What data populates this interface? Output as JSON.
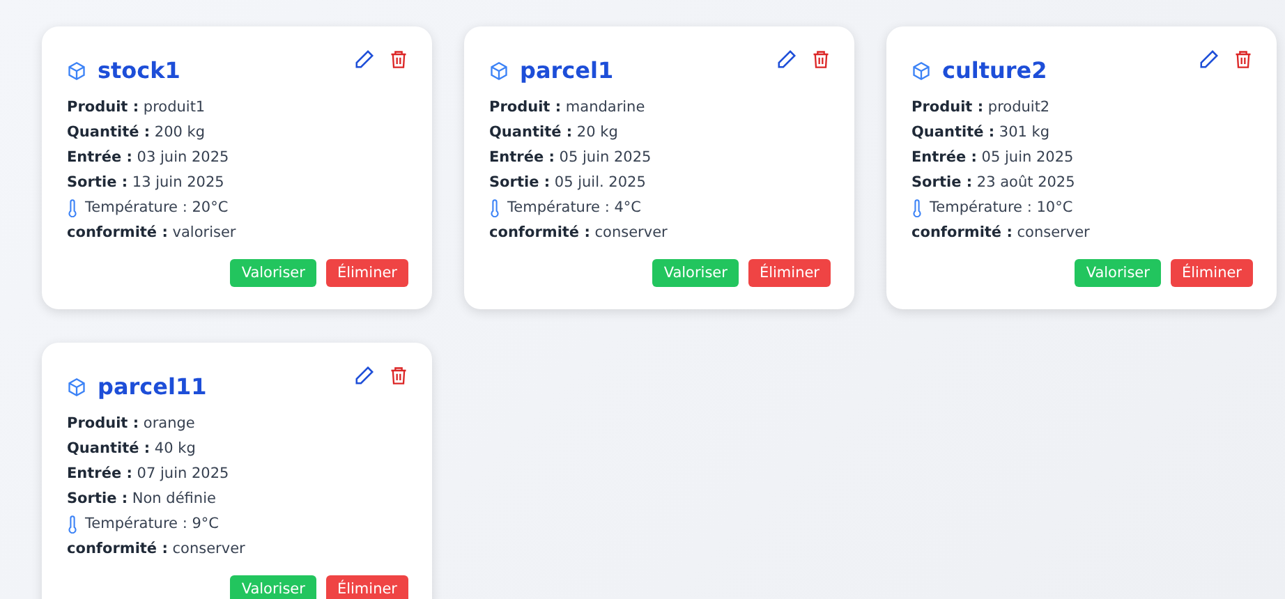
{
  "cards": [
    {
      "title": "stock1",
      "lines": [
        {
          "kind": "field",
          "label": "Produit :",
          "value": "produit1"
        },
        {
          "kind": "field",
          "label": "Quantité :",
          "value": "200 kg"
        },
        {
          "kind": "field",
          "label": "Entrée :",
          "value": "03 juin 2025"
        },
        {
          "kind": "field",
          "label": "Sortie :",
          "value": "13 juin 2025"
        },
        {
          "kind": "temperature",
          "value": "Température : 20°C"
        },
        {
          "kind": "field",
          "label": "conformité :",
          "value": "valoriser"
        }
      ],
      "buttons": [
        {
          "kind": "valorize",
          "label": "Valoriser"
        },
        {
          "kind": "delete",
          "label": "Éliminer"
        }
      ]
    },
    {
      "title": "parcel1",
      "lines": [
        {
          "kind": "field",
          "label": "Produit :",
          "value": "mandarine"
        },
        {
          "kind": "field",
          "label": "Quantité :",
          "value": "20 kg"
        },
        {
          "kind": "field",
          "label": "Entrée :",
          "value": "05 juin 2025"
        },
        {
          "kind": "field",
          "label": "Sortie :",
          "value": "05 juil. 2025"
        },
        {
          "kind": "temperature",
          "value": "Température : 4°C"
        },
        {
          "kind": "field",
          "label": "conformité :",
          "value": "conserver"
        }
      ],
      "buttons": [
        {
          "kind": "valorize",
          "label": "Valoriser"
        },
        {
          "kind": "delete",
          "label": "Éliminer"
        }
      ]
    },
    {
      "title": "culture2",
      "lines": [
        {
          "kind": "field",
          "label": "Produit :",
          "value": "produit2"
        },
        {
          "kind": "field",
          "label": "Quantité :",
          "value": "301 kg"
        },
        {
          "kind": "field",
          "label": "Entrée :",
          "value": "05 juin 2025"
        },
        {
          "kind": "field",
          "label": "Sortie :",
          "value": "23 août 2025"
        },
        {
          "kind": "temperature",
          "value": "Température : 10°C"
        },
        {
          "kind": "field",
          "label": "conformité :",
          "value": "conserver"
        }
      ],
      "buttons": [
        {
          "kind": "valorize",
          "label": "Valoriser"
        },
        {
          "kind": "delete",
          "label": "Éliminer"
        }
      ]
    },
    {
      "title": "parcel11",
      "lines": [
        {
          "kind": "field",
          "label": "Produit :",
          "value": "orange"
        },
        {
          "kind": "field",
          "label": "Quantité :",
          "value": "40 kg"
        },
        {
          "kind": "field",
          "label": "Entrée :",
          "value": "07 juin 2025"
        },
        {
          "kind": "field",
          "label": "Sortie :",
          "value": "Non définie"
        },
        {
          "kind": "temperature",
          "value": "Température : 9°C"
        },
        {
          "kind": "field",
          "label": "conformité :",
          "value": "conserver"
        }
      ],
      "buttons": [
        {
          "kind": "valorize",
          "label": "Valoriser"
        },
        {
          "kind": "delete",
          "label": "Éliminer"
        }
      ]
    }
  ]
}
